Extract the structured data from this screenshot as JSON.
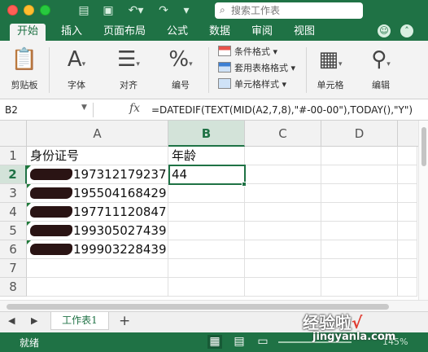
{
  "search": {
    "placeholder": "搜索工作表"
  },
  "tabs": [
    {
      "label": "开始",
      "active": true
    },
    {
      "label": "插入"
    },
    {
      "label": "页面布局"
    },
    {
      "label": "公式"
    },
    {
      "label": "数据"
    },
    {
      "label": "审阅"
    },
    {
      "label": "视图"
    }
  ],
  "ribbon": {
    "paste": "剪贴板",
    "font": "字体",
    "align": "对齐",
    "number": "编号",
    "conditional": "条件格式",
    "table_format": "套用表格格式",
    "cell_style": "单元格样式",
    "cells": "单元格",
    "edit": "编辑"
  },
  "formula_bar": {
    "cell_ref": "B2",
    "fx": "fx",
    "formula": "=DATEDIF(TEXT(MID(A2,7,8),\"#-00-00\"),TODAY(),\"Y\")"
  },
  "columns": [
    "A",
    "B",
    "C",
    "D"
  ],
  "rows": [
    "1",
    "2",
    "3",
    "4",
    "5",
    "6",
    "7",
    "8"
  ],
  "cells": {
    "A1": "身份证号",
    "B1": "年龄",
    "A2": "197312179237",
    "B2": "44",
    "A3": "195504168429",
    "A4": "197711120847",
    "A5": "199305027439",
    "A6": "199903228439"
  },
  "sheet": {
    "tab": "工作表1",
    "add": "+"
  },
  "status": {
    "text": "就绪",
    "zoom": "145%"
  },
  "watermark": {
    "line1": "经验啦",
    "check": "√",
    "line2": "jingyanla.com"
  },
  "colors": {
    "accent": "#1f7245"
  }
}
